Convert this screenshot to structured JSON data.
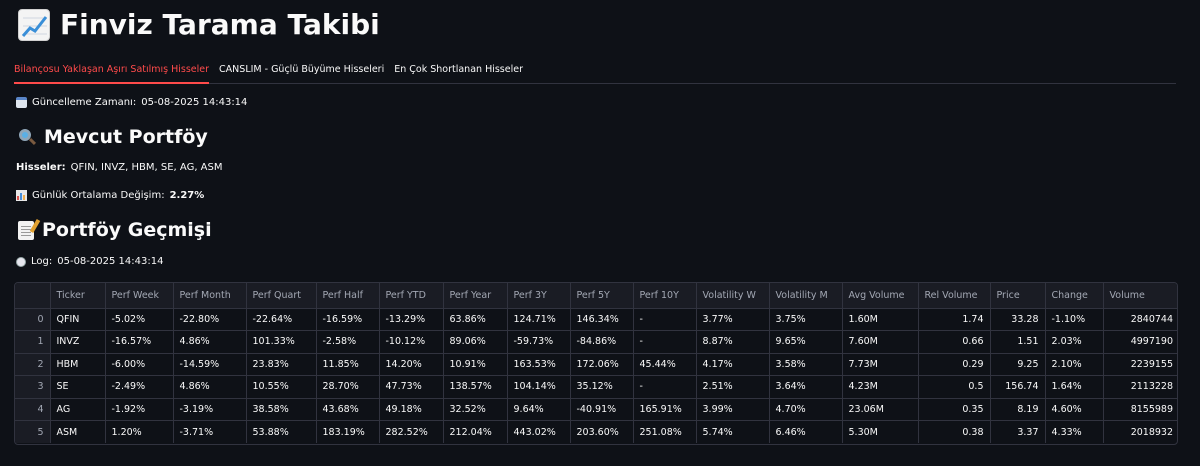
{
  "header": {
    "title": "Finviz Tarama Takibi",
    "icon": "chart-increasing-icon"
  },
  "tabs": [
    {
      "label": "Bilançosu Yaklaşan Aşırı Satılmış Hisseler",
      "active": true
    },
    {
      "label": "CANSLIM - Güçlü Büyüme Hisseleri",
      "active": false
    },
    {
      "label": "En Çok Shortlanan Hisseler",
      "active": false
    }
  ],
  "update": {
    "label": "Güncelleme Zamanı:",
    "value": "05-08-2025 14:43:14"
  },
  "portfolio": {
    "title": "Mevcut Portföy",
    "stocks_label": "Hisseler:",
    "stocks_value": "QFIN, INVZ, HBM, SE, AG, ASM",
    "avg_label": "Günlük Ortalama Değişim:",
    "avg_value": "2.27%"
  },
  "history": {
    "title": "Portföy Geçmişi",
    "log_label": "Log:",
    "log_value": "05-08-2025 14:43:14"
  },
  "table": {
    "columns": [
      "",
      "Ticker",
      "Perf Week",
      "Perf Month",
      "Perf Quart",
      "Perf Half",
      "Perf YTD",
      "Perf Year",
      "Perf 3Y",
      "Perf 5Y",
      "Perf 10Y",
      "Volatility W",
      "Volatility M",
      "Avg Volume",
      "Rel Volume",
      "Price",
      "Change",
      "Volume"
    ],
    "rows": [
      [
        "0",
        "QFIN",
        "-5.02%",
        "-22.80%",
        "-22.64%",
        "-16.59%",
        "-13.29%",
        "63.86%",
        "124.71%",
        "146.34%",
        "-",
        "3.77%",
        "3.75%",
        "1.60M",
        "1.74",
        "33.28",
        "-1.10%",
        "2840744"
      ],
      [
        "1",
        "INVZ",
        "-16.57%",
        "4.86%",
        "101.33%",
        "-2.58%",
        "-10.12%",
        "89.06%",
        "-59.73%",
        "-84.86%",
        "-",
        "8.87%",
        "9.65%",
        "7.60M",
        "0.66",
        "1.51",
        "2.03%",
        "4997190"
      ],
      [
        "2",
        "HBM",
        "-6.00%",
        "-14.59%",
        "23.83%",
        "11.85%",
        "14.20%",
        "10.91%",
        "163.53%",
        "172.06%",
        "45.44%",
        "4.17%",
        "3.58%",
        "7.73M",
        "0.29",
        "9.25",
        "2.10%",
        "2239155"
      ],
      [
        "3",
        "SE",
        "-2.49%",
        "4.86%",
        "10.55%",
        "28.70%",
        "47.73%",
        "138.57%",
        "104.14%",
        "35.12%",
        "-",
        "2.51%",
        "3.64%",
        "4.23M",
        "0.5",
        "156.74",
        "1.64%",
        "2113228"
      ],
      [
        "4",
        "AG",
        "-1.92%",
        "-3.19%",
        "38.58%",
        "43.68%",
        "49.18%",
        "32.52%",
        "9.64%",
        "-40.91%",
        "165.91%",
        "3.99%",
        "4.70%",
        "23.06M",
        "0.35",
        "8.19",
        "4.60%",
        "8155989"
      ],
      [
        "5",
        "ASM",
        "1.20%",
        "-3.71%",
        "53.88%",
        "183.19%",
        "282.52%",
        "212.04%",
        "443.02%",
        "203.60%",
        "251.08%",
        "5.74%",
        "6.46%",
        "5.30M",
        "0.38",
        "3.37",
        "4.33%",
        "2018932"
      ]
    ]
  }
}
